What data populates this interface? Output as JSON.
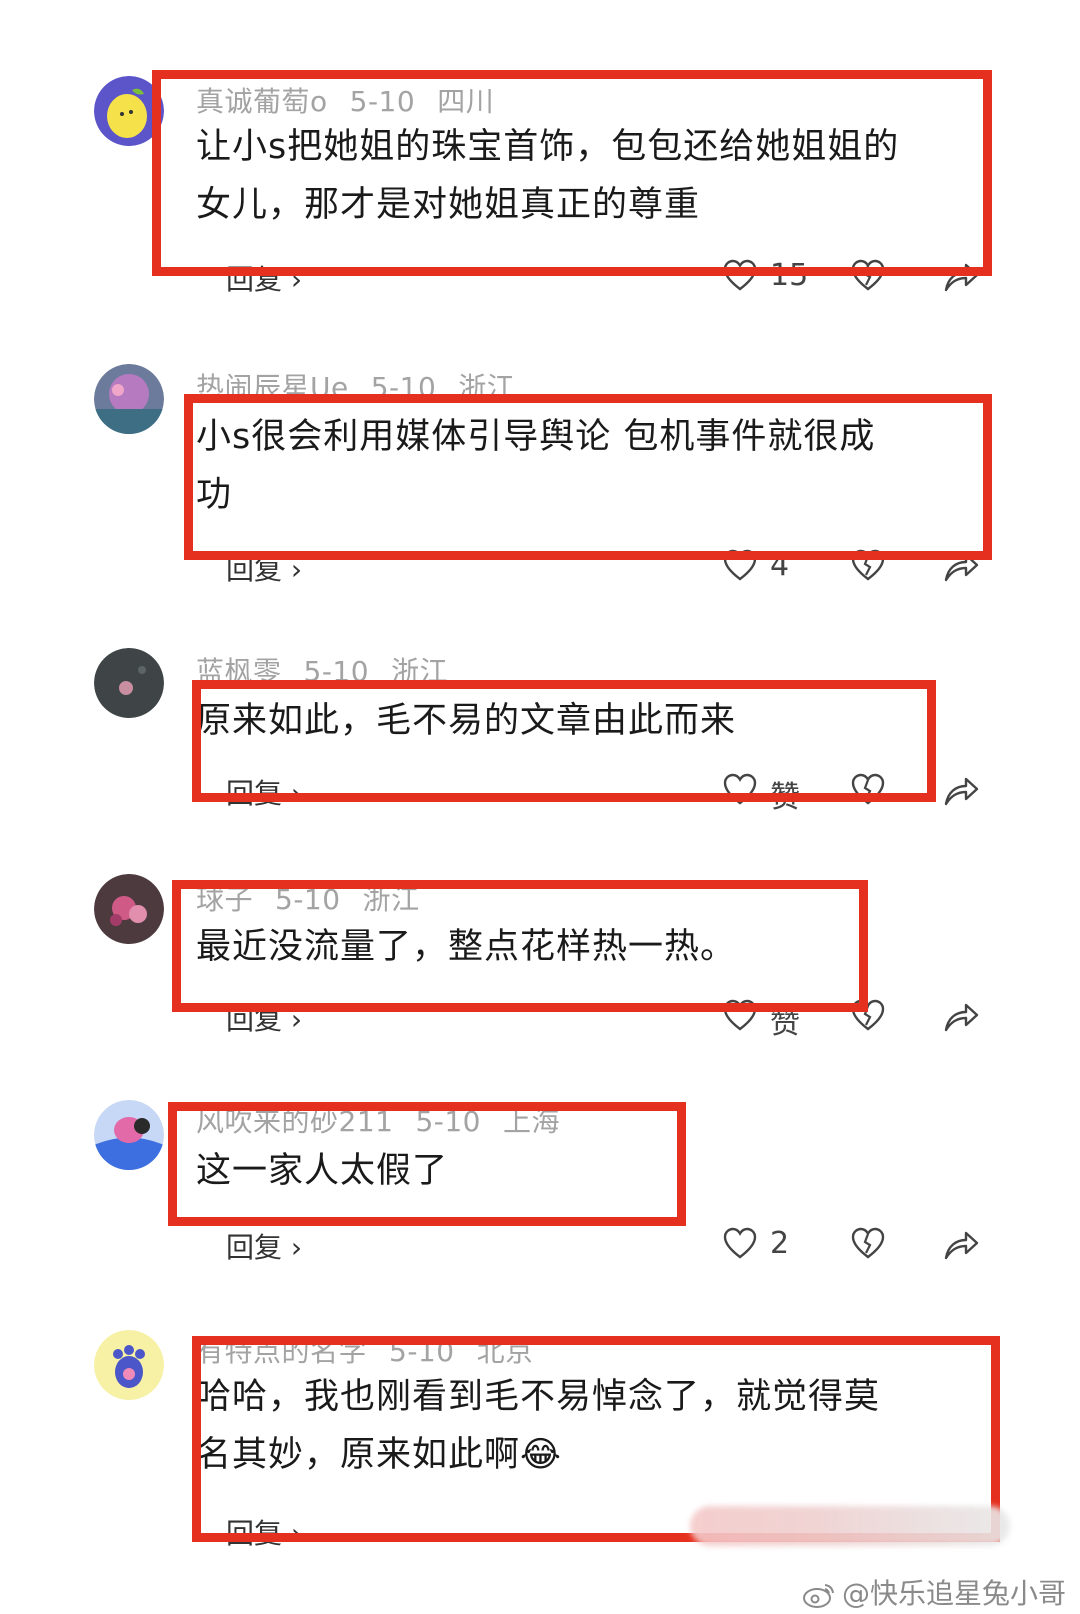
{
  "comments": [
    {
      "user": "真诚葡萄o",
      "date": "5-10",
      "location": "四川",
      "lines": [
        "让小s把她姐的珠宝首饰，包包还给她姐姐的",
        "女儿，那才是对她姐真正的尊重"
      ],
      "reply_label": "回复 ›",
      "likes": "15"
    },
    {
      "user": "热闹辰星Ue",
      "date": "5-10",
      "location": "浙江",
      "lines": [
        "小s很会利用媒体引导舆论 包机事件就很成",
        "功"
      ],
      "reply_label": "回复 ›",
      "likes": "4"
    },
    {
      "user": "蓝枫零",
      "date": "5-10",
      "location": "浙江",
      "lines": [
        "原来如此，毛不易的文章由此而来"
      ],
      "reply_label": "回复 ›",
      "likes": "赞"
    },
    {
      "user": "球子",
      "date": "5-10",
      "location": "浙江",
      "lines": [
        "最近没流量了，整点花样热一热。"
      ],
      "reply_label": "回复 ›",
      "likes": "赞"
    },
    {
      "user": "风吹来的砂211",
      "date": "5-10",
      "location": "上海",
      "lines": [
        "这一家人太假了"
      ],
      "reply_label": "回复 ›",
      "likes": "2"
    },
    {
      "user": "有特点的名字",
      "date": "5-10",
      "location": "北京",
      "lines": [
        "哈哈，我也刚看到毛不易悼念了，就觉得莫",
        "名其妙，原来如此啊😂"
      ],
      "reply_label": "回复 ›",
      "likes": ""
    }
  ],
  "watermark": "@快乐追星兔小哥",
  "icons": {
    "like": "heart-outline-icon",
    "dislike": "broken-heart-icon",
    "share": "share-arrow-icon",
    "watermark": "weibo-logo-icon"
  },
  "colors": {
    "highlight_box": "#e5301f",
    "meta_text": "#a3a3a3"
  }
}
